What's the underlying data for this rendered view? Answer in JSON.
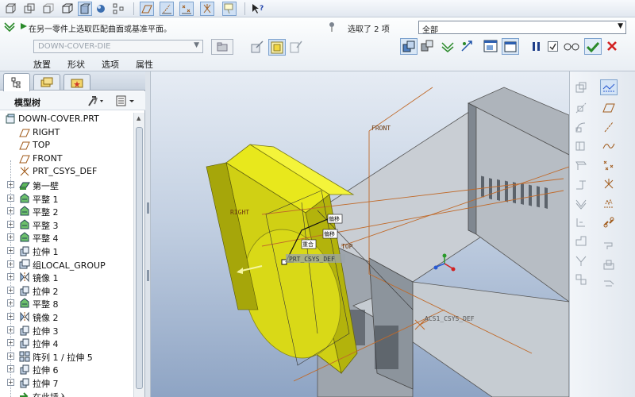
{
  "toolbar": {
    "icons": [
      "spin-center-icon",
      "display-wireframe-icon",
      "display-hidden-line-icon",
      "display-no-hidden-icon",
      "display-shading-icon",
      "spin-point-icon",
      "datum-plane-display-icon",
      "datum-axis-display-icon",
      "datum-point-display-icon",
      "csys-display-icon",
      "annotation-display-icon",
      "context-help-icon"
    ]
  },
  "dashboard": {
    "message": "在另一零件上选取匹配曲面或基准平面。",
    "selection_count": "选取了 2 项",
    "filter_value": "全部",
    "reference_value": "DOWN-COVER-DIE",
    "tabs": [
      "放置",
      "形状",
      "选项",
      "属性"
    ],
    "accent_color": "#2a8a2a",
    "cancel_color": "#d22020"
  },
  "panel": {
    "tree_title": "模型树",
    "tree_items": [
      {
        "label": "DOWN-COVER.PRT",
        "icon": "part-icon",
        "expander": ""
      },
      {
        "label": "RIGHT",
        "icon": "datum-plane-icon",
        "expander": ""
      },
      {
        "label": "TOP",
        "icon": "datum-plane-icon",
        "expander": ""
      },
      {
        "label": "FRONT",
        "icon": "datum-plane-icon",
        "expander": ""
      },
      {
        "label": "PRT_CSYS_DEF",
        "icon": "csys-icon",
        "expander": ""
      },
      {
        "label": "第一壁",
        "icon": "first-wall-icon",
        "expander": "+"
      },
      {
        "label": "平整 1",
        "icon": "flat-wall-icon",
        "expander": "+"
      },
      {
        "label": "平整 2",
        "icon": "flat-wall-icon",
        "expander": "+"
      },
      {
        "label": "平整 3",
        "icon": "flat-wall-icon",
        "expander": "+"
      },
      {
        "label": "平整 4",
        "icon": "flat-wall-icon",
        "expander": "+"
      },
      {
        "label": "拉伸 1",
        "icon": "extrude-icon",
        "expander": "+"
      },
      {
        "label": "组LOCAL_GROUP",
        "icon": "group-icon",
        "expander": "+"
      },
      {
        "label": "镜像 1",
        "icon": "mirror-icon",
        "expander": "+"
      },
      {
        "label": "拉伸 2",
        "icon": "extrude-icon",
        "expander": "+"
      },
      {
        "label": "平整 8",
        "icon": "flat-wall-icon",
        "expander": "+"
      },
      {
        "label": "镜像 2",
        "icon": "mirror-icon",
        "expander": "+"
      },
      {
        "label": "拉伸 3",
        "icon": "extrude-icon",
        "expander": "+"
      },
      {
        "label": "拉伸 4",
        "icon": "extrude-icon",
        "expander": "+"
      },
      {
        "label": "阵列 1 / 拉伸 5",
        "icon": "pattern-icon",
        "expander": "+"
      },
      {
        "label": "拉伸 6",
        "icon": "extrude-icon",
        "expander": "+"
      },
      {
        "label": "拉伸 7",
        "icon": "extrude-icon",
        "expander": "+"
      },
      {
        "label": "在此插入",
        "icon": "insert-here-icon",
        "expander": ""
      }
    ]
  },
  "viewport": {
    "labels": {
      "front": "FRONT",
      "right": "RIGHT",
      "top": "TOP",
      "csys": "PRT_CSYS_DEF",
      "acsys": "ACS1_CSYS_DEF",
      "tag1": "偏移",
      "tag2": "偏移",
      "tag3": "重合"
    },
    "colors": {
      "die_yellow": "#e4e416",
      "part_gray": "#bfc5cc",
      "datum_orange": "#c06a2a"
    }
  },
  "right_toolbar": {
    "icons": [
      "datum-plane-tool-icon",
      "datum-axis-tool-icon",
      "datum-curve-tool-icon",
      "datum-point-tool-icon",
      "csys-tool-icon",
      "sketch-tool-icon",
      "flat-wall-tool-icon",
      "flange-wall-tool-icon",
      "extrude-tool-icon",
      "unbend-tool-icon",
      "bend-back-tool-icon",
      "corner-relief-tool-icon",
      "form-tool-icon",
      "rip-tool-icon",
      "merge-tool-icon"
    ]
  }
}
